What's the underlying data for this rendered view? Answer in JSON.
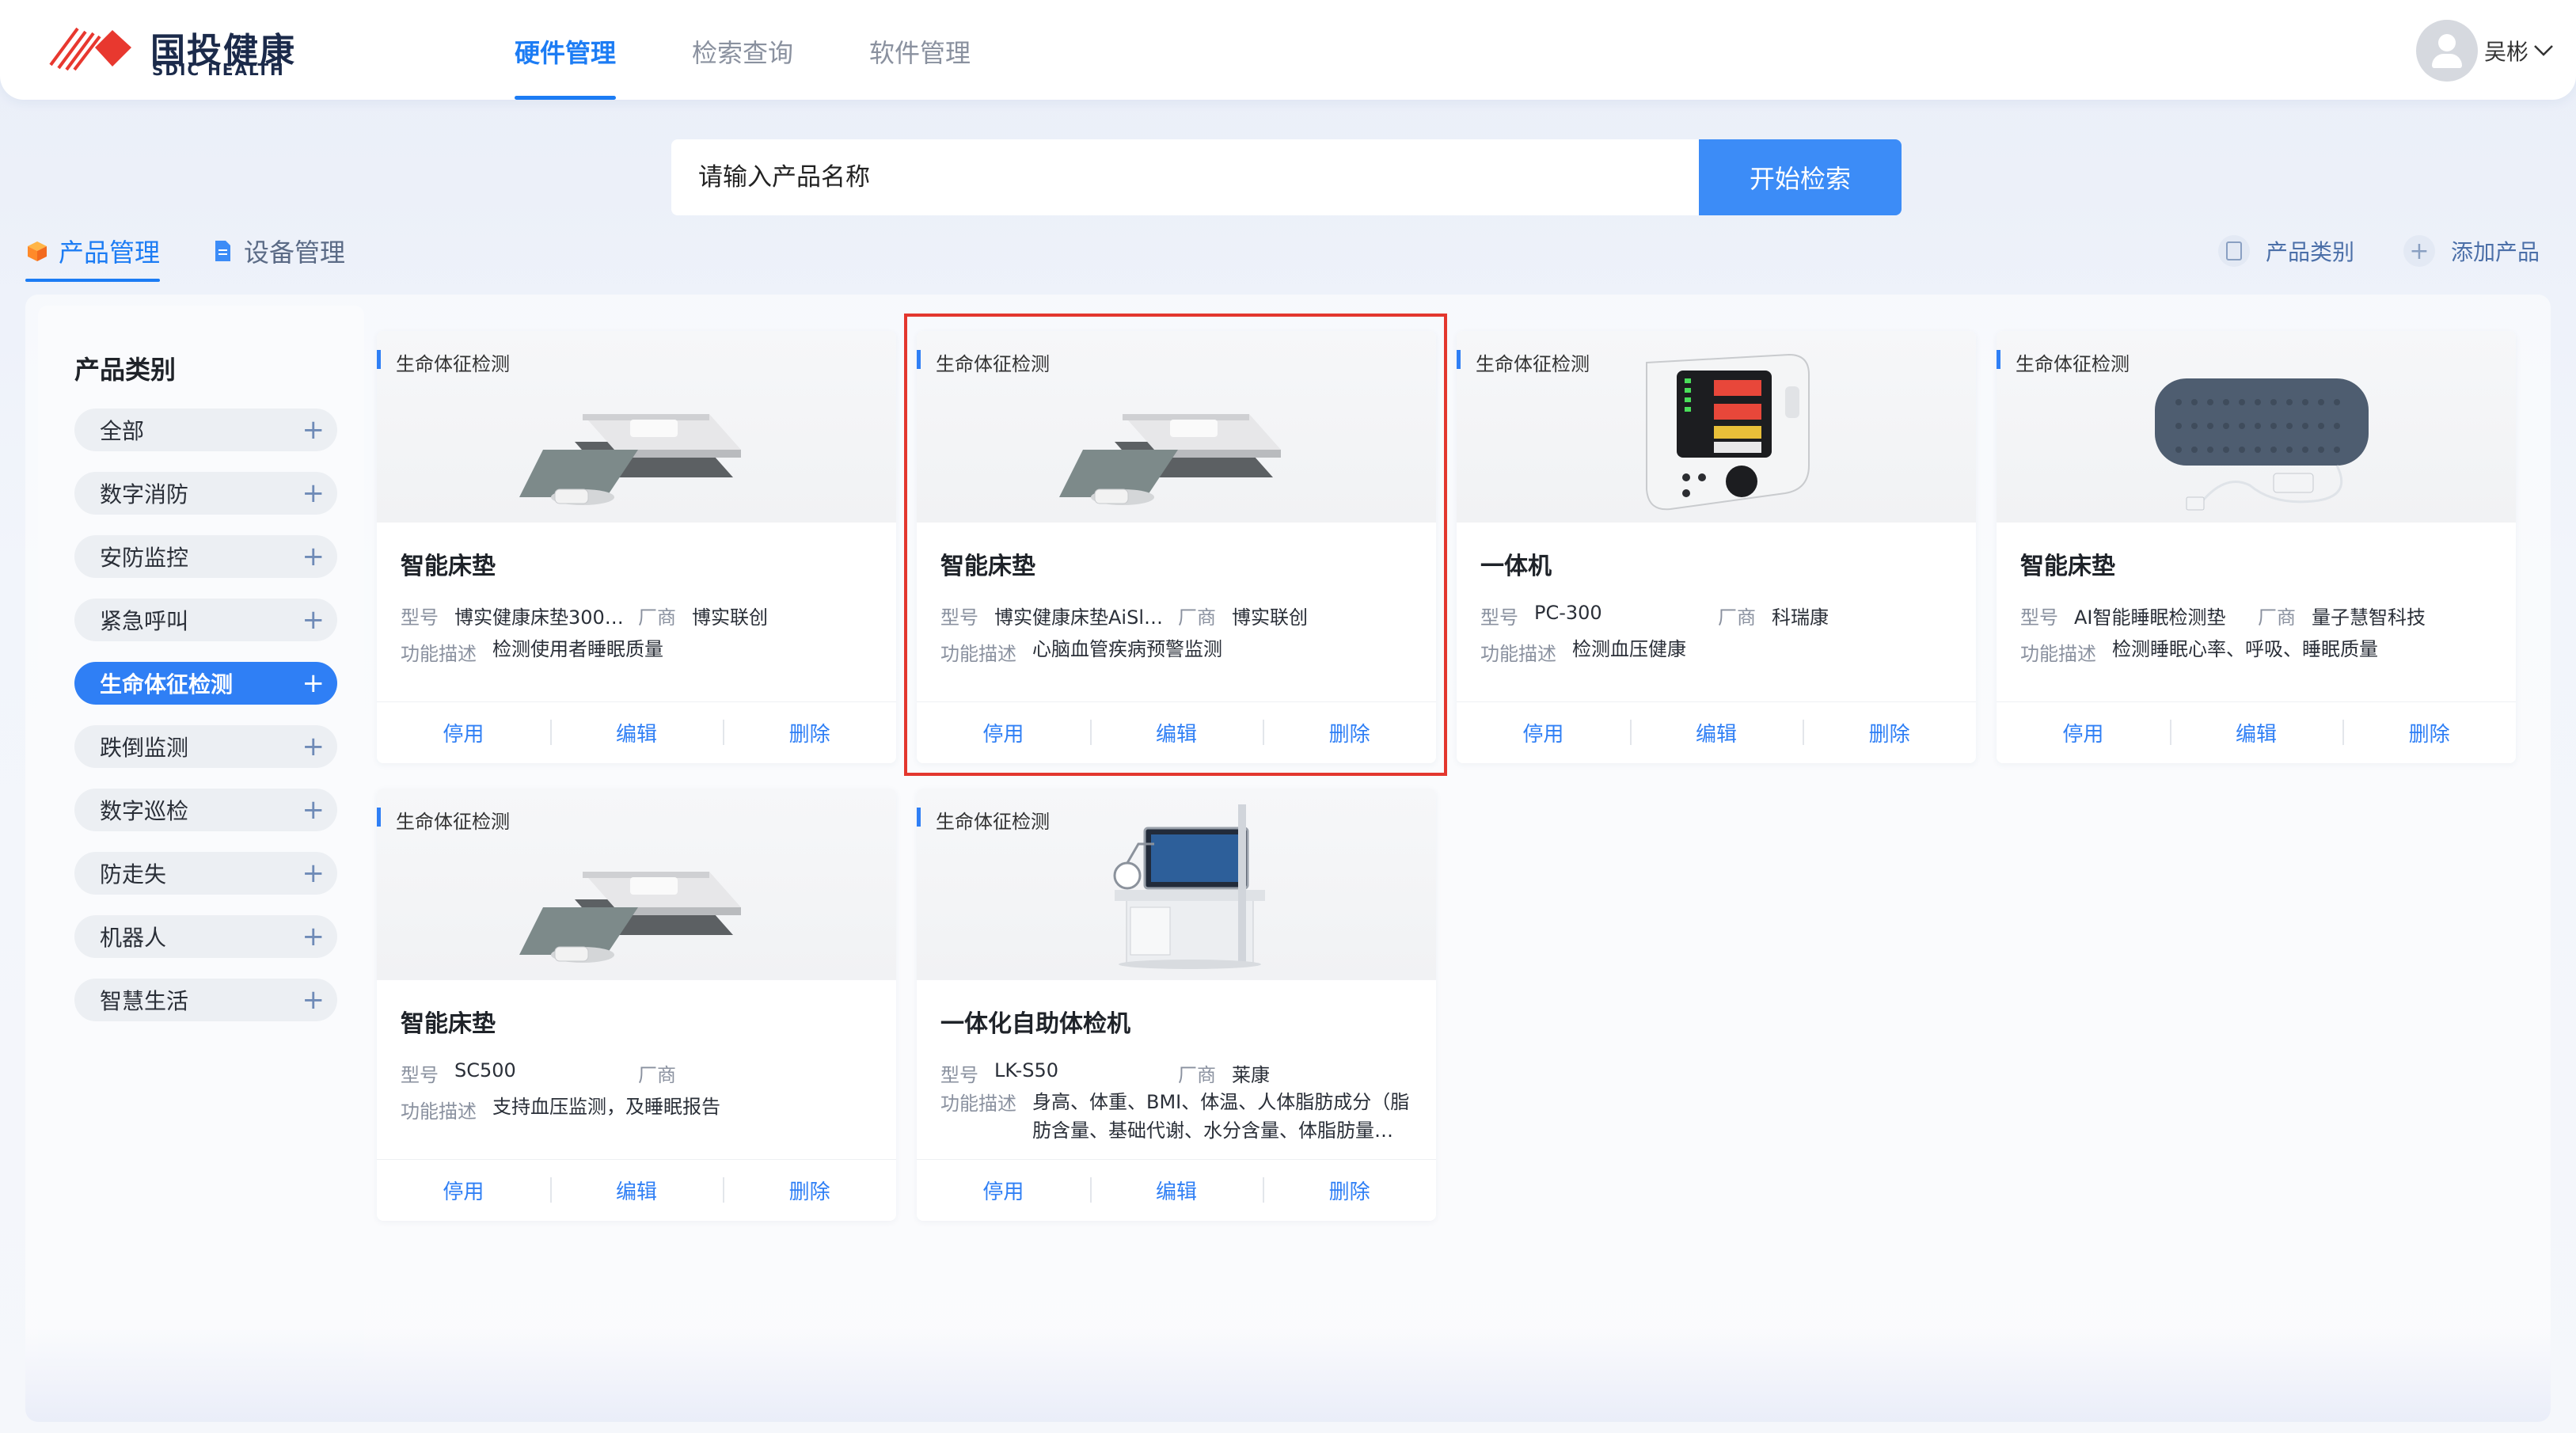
{
  "header": {
    "brand_cn": "国投健康",
    "brand_en": "SDIC HEALTH",
    "nav": [
      {
        "label": "硬件管理",
        "active": true
      },
      {
        "label": "检索查询",
        "active": false
      },
      {
        "label": "软件管理",
        "active": false
      }
    ],
    "user_name": "吴彬",
    "brand_color": "#e8382f",
    "accent_color": "#1c7cf4"
  },
  "search": {
    "placeholder": "请输入产品名称",
    "button_label": "开始检索"
  },
  "tabs": [
    {
      "label": "产品管理",
      "active": true,
      "icon": "cube-icon"
    },
    {
      "label": "设备管理",
      "active": false,
      "icon": "document-icon"
    }
  ],
  "actions": {
    "category_label": "产品类别",
    "add_label": "添加产品"
  },
  "sidebar": {
    "title": "产品类别",
    "items": [
      {
        "label": "全部",
        "active": false
      },
      {
        "label": "数字消防",
        "active": false
      },
      {
        "label": "安防监控",
        "active": false
      },
      {
        "label": "紧急呼叫",
        "active": false
      },
      {
        "label": "生命体征检测",
        "active": true
      },
      {
        "label": "跌倒监测",
        "active": false
      },
      {
        "label": "数字巡检",
        "active": false
      },
      {
        "label": "防走失",
        "active": false
      },
      {
        "label": "机器人",
        "active": false
      },
      {
        "label": "智慧生活",
        "active": false
      }
    ]
  },
  "labels": {
    "model": "型号",
    "vendor": "厂商",
    "desc": "功能描述",
    "disable": "停用",
    "edit": "编辑",
    "delete": "删除"
  },
  "cards": [
    {
      "tag": "生命体征检测",
      "title": "智能床垫",
      "model": "博实健康床垫300…",
      "vendor": "博实联创",
      "desc": "检测使用者睡眠质量",
      "image": "mattress-sensor"
    },
    {
      "tag": "生命体征检测",
      "title": "智能床垫",
      "model": "博实健康床垫AiSle…",
      "vendor": "博实联创",
      "desc": "心脑血管疾病预警监测",
      "image": "mattress-sensor",
      "selected": true
    },
    {
      "tag": "生命体征检测",
      "title": "一体机",
      "model": "PC-300",
      "vendor": "科瑞康",
      "desc": "检测血压健康",
      "image": "blood-pressure-monitor"
    },
    {
      "tag": "生命体征检测",
      "title": "智能床垫",
      "model": "AI智能睡眠检测垫",
      "vendor": "量子慧智科技",
      "desc": "检测睡眠心率、呼吸、睡眠质量",
      "image": "sleep-pad"
    },
    {
      "tag": "生命体征检测",
      "title": "智能床垫",
      "model": "SC500",
      "vendor": "",
      "desc": "支持血压监测，及睡眠报告",
      "image": "mattress-sensor"
    },
    {
      "tag": "生命体征检测",
      "title": "一体化自助体检机",
      "model": "LK-S50",
      "vendor": "莱康",
      "desc": "身高、体重、BMI、体温、人体脂肪成分（脂肪含量、基础代谢、水分含量、体脂肪量…",
      "image": "health-kiosk"
    }
  ]
}
